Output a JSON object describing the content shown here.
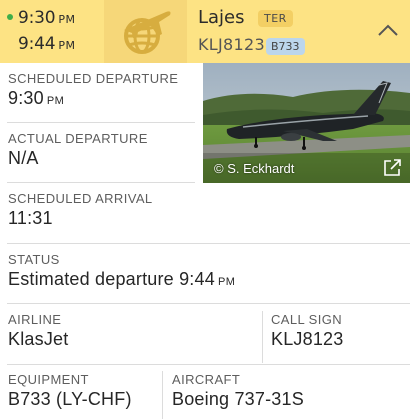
{
  "header": {
    "departure_time": "9:30",
    "departure_ampm": "PM",
    "estimated_time": "9:44",
    "estimated_ampm": "PM",
    "status_dot_color": "#3fae49",
    "airline_logo_icon": "airline-globe-plane-icon",
    "airport_name": "Lajes",
    "airport_code": "TER",
    "flight_number": "KLJ8123",
    "aircraft_badge": "B733",
    "collapse_icon": "chevron-up-icon",
    "background_color": "#fde384"
  },
  "photo": {
    "credit": "© S. Eckhardt",
    "external_link_icon": "external-link-icon"
  },
  "details": {
    "scheduled_departure_label": "SCHEDULED DEPARTURE",
    "scheduled_departure_time": "9:30",
    "scheduled_departure_ampm": "PM",
    "actual_departure_label": "ACTUAL DEPARTURE",
    "actual_departure_value": "N/A",
    "scheduled_arrival_label": "SCHEDULED ARRIVAL",
    "scheduled_arrival_value": "11:31",
    "status_label": "STATUS",
    "status_value": "Estimated departure 9:44",
    "status_ampm": "PM",
    "airline_label": "AIRLINE",
    "airline_value": "KlasJet",
    "call_sign_label": "CALL SIGN",
    "call_sign_value": "KLJ8123",
    "equipment_label": "EQUIPMENT",
    "equipment_value": "B733 (LY-CHF)",
    "aircraft_label": "AIRCRAFT",
    "aircraft_value": "Boeing 737-31S"
  }
}
